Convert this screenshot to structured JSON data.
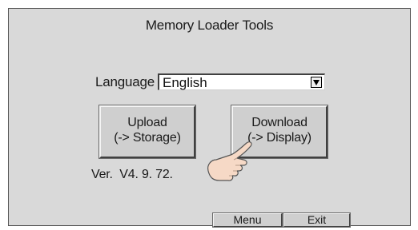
{
  "app": {
    "title": "Memory Loader Tools"
  },
  "language": {
    "label": "Language",
    "selected": "English",
    "arrow_icon": "dropdown-arrow-icon"
  },
  "buttons": {
    "upload": {
      "line1": "Upload",
      "line2": "(-> Storage)"
    },
    "download": {
      "line1": "Download",
      "line2": "(-> Display)"
    },
    "menu": "Menu",
    "exit": "Exit"
  },
  "version": {
    "label": "Ver.",
    "value": "V4. 9. 72."
  },
  "overlay": {
    "icon": "pointing-hand-icon"
  },
  "colors": {
    "screen_bg": "#d9d9d9",
    "button_face": "#cfcfcf",
    "select_bg": "#ffffff",
    "text": "#1a1a1a"
  }
}
